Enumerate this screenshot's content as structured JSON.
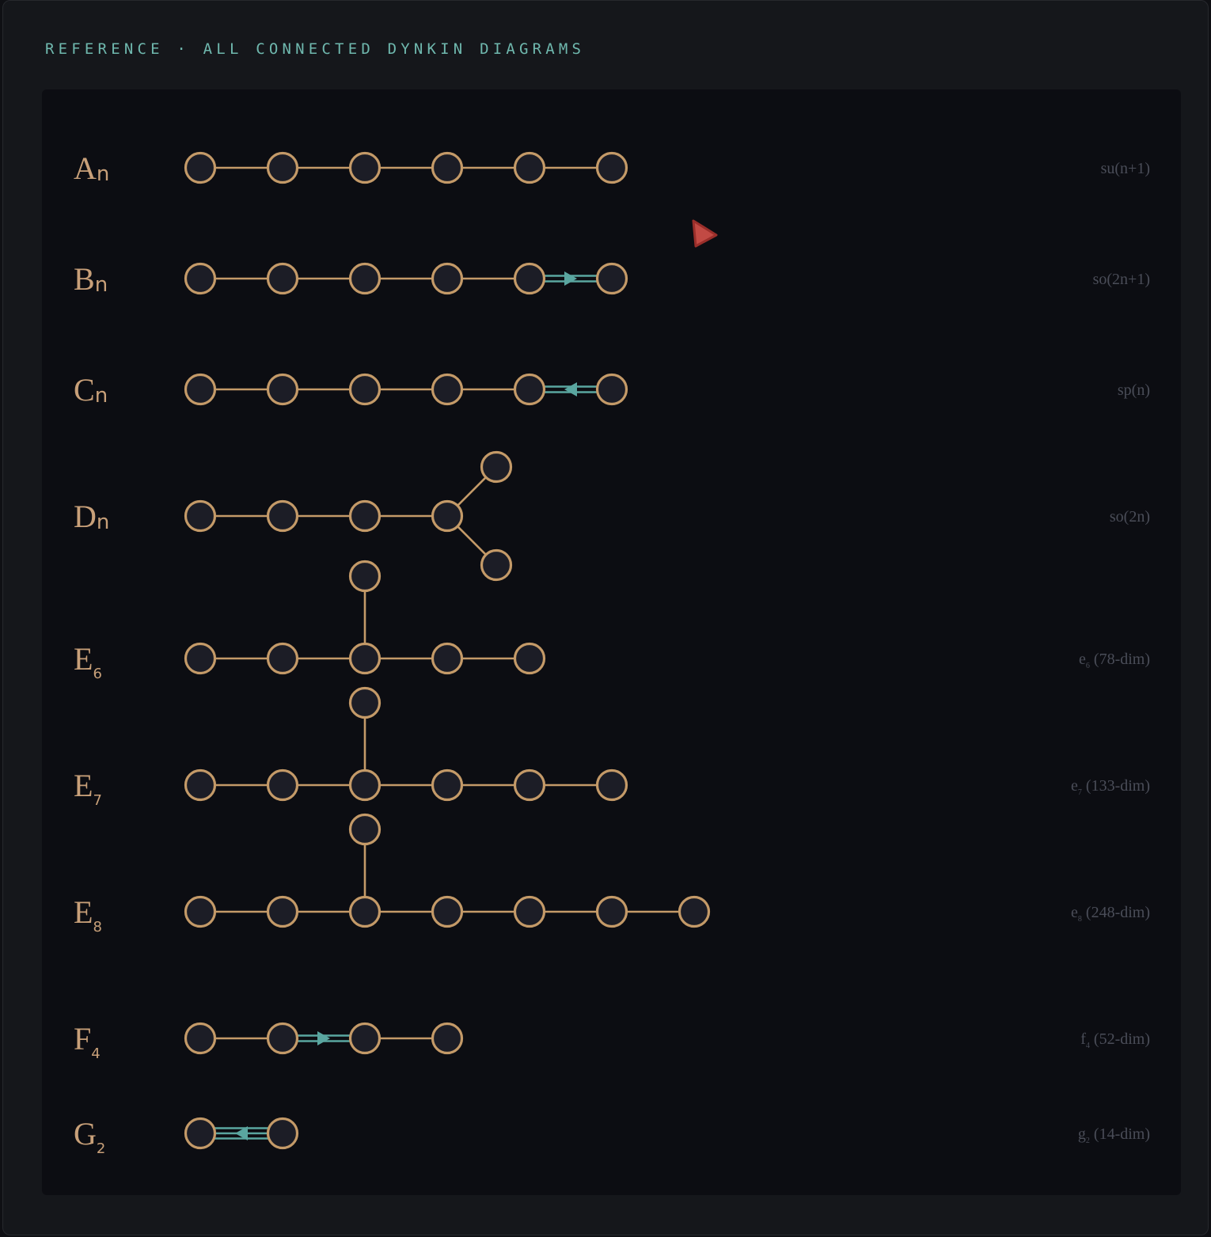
{
  "header": {
    "title": "REFERENCE · ALL CONNECTED DYNKIN DIAGRAMS"
  },
  "colors": {
    "background": "#15171b",
    "panel": "#0c0d12",
    "node_stroke": "#c49a68",
    "node_fill": "#1c1d26",
    "edge": "#c49a68",
    "multi_edge": "#5aa6a0",
    "label": "#c8a079",
    "algebra_text": "#4a4d58",
    "header_text": "#6fb8ae"
  },
  "diagrams": [
    {
      "id": "A",
      "letter": "A",
      "sub": "n",
      "algebra_main": "su(n+1)",
      "algebra_sub": "",
      "algebra_tail": "",
      "nodes": 6,
      "branch": null,
      "extra": [],
      "multi": null
    },
    {
      "id": "B",
      "letter": "B",
      "sub": "n",
      "algebra_main": "so(2n+1)",
      "algebra_sub": "",
      "algebra_tail": "",
      "nodes": 6,
      "branch": null,
      "extra": [],
      "multi": {
        "between": [
          4,
          5
        ],
        "lines": 2,
        "arrow": "right"
      }
    },
    {
      "id": "C",
      "letter": "C",
      "sub": "n",
      "algebra_main": "sp(n)",
      "algebra_sub": "",
      "algebra_tail": "",
      "nodes": 6,
      "branch": null,
      "extra": [],
      "multi": {
        "between": [
          4,
          5
        ],
        "lines": 2,
        "arrow": "left"
      }
    },
    {
      "id": "D",
      "letter": "D",
      "sub": "n",
      "algebra_main": "so(2n)",
      "algebra_sub": "",
      "algebra_tail": "",
      "nodes": 4,
      "branch": "fork",
      "extra": [],
      "multi": null
    },
    {
      "id": "E6",
      "letter": "E",
      "sub": "6",
      "algebra_main": "e",
      "algebra_sub": "6",
      "algebra_tail": " (78-dim)",
      "nodes": 5,
      "branch": "up",
      "branch_at": 2,
      "extra": [],
      "multi": null
    },
    {
      "id": "E7",
      "letter": "E",
      "sub": "7",
      "algebra_main": "e",
      "algebra_sub": "7",
      "algebra_tail": " (133-dim)",
      "nodes": 6,
      "branch": "up",
      "branch_at": 2,
      "extra": [],
      "multi": null
    },
    {
      "id": "E8",
      "letter": "E",
      "sub": "8",
      "algebra_main": "e",
      "algebra_sub": "8",
      "algebra_tail": " (248-dim)",
      "nodes": 7,
      "branch": "up",
      "branch_at": 2,
      "extra": [],
      "multi": null
    },
    {
      "id": "F4",
      "letter": "F",
      "sub": "4",
      "algebra_main": "f",
      "algebra_sub": "4",
      "algebra_tail": " (52-dim)",
      "nodes": 4,
      "branch": null,
      "extra": [],
      "multi": {
        "between": [
          1,
          2
        ],
        "lines": 2,
        "arrow": "right"
      }
    },
    {
      "id": "G2",
      "letter": "G",
      "sub": "2",
      "algebra_main": "g",
      "algebra_sub": "2",
      "algebra_tail": " (14-dim)",
      "nodes": 2,
      "branch": null,
      "extra": [],
      "multi": {
        "between": [
          0,
          1
        ],
        "lines": 3,
        "arrow": "left"
      }
    }
  ]
}
